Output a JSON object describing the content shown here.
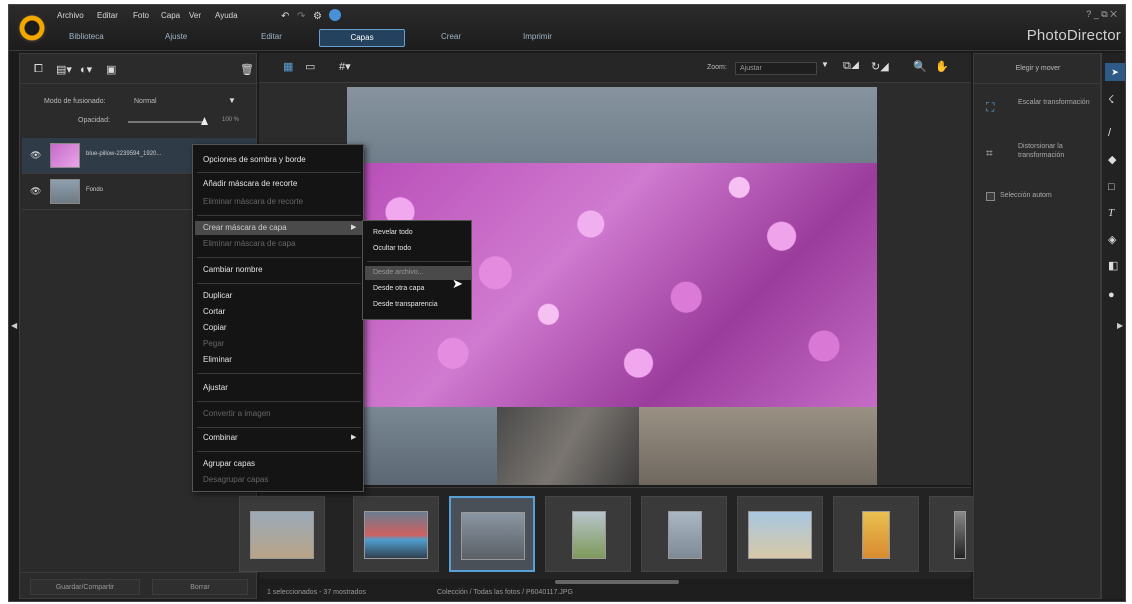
{
  "menu": [
    "Archivo",
    "Editar",
    "Foto",
    "Capa",
    "Ver",
    "Ayuda"
  ],
  "tabs": [
    "Biblioteca",
    "Ajuste",
    "Editar",
    "Capas",
    "Crear",
    "Imprimir"
  ],
  "brand": "PhotoDirector",
  "window_controls": "?  _  ⧉  ✕",
  "left_panel": {
    "blend_label": "Modo de fusionado:",
    "blend_value": "Normal",
    "opacity_label": "Opacidad:",
    "opacity_value": "100 %",
    "opacity_level": 1.0,
    "layers": [
      {
        "name": "blue-pillow-2239594_1920..."
      },
      {
        "name": "Fondo"
      }
    ],
    "save_share": "Guardar/Compartir",
    "delete": "Borrar"
  },
  "toolbar": {
    "zoom_label": "Zoom:",
    "zoom_value": "Ajustar"
  },
  "context_menu": {
    "items": [
      {
        "label": "Opciones de sombra y borde",
        "enabled": true
      },
      {
        "label": "Añadir máscara de recorte",
        "enabled": true
      },
      {
        "label": "Eliminar máscara de recorte",
        "enabled": false
      },
      {
        "label": "Crear máscara de capa",
        "enabled": true,
        "highlighted": true,
        "submenu": true
      },
      {
        "label": "Eliminar máscara de capa",
        "enabled": false
      },
      {
        "label": "Cambiar nombre",
        "enabled": true
      },
      {
        "label": "Duplicar",
        "enabled": true
      },
      {
        "label": "Cortar",
        "enabled": true
      },
      {
        "label": "Copiar",
        "enabled": true
      },
      {
        "label": "Pegar",
        "enabled": false
      },
      {
        "label": "Eliminar",
        "enabled": true
      },
      {
        "label": "Ajustar",
        "enabled": true
      },
      {
        "label": "Convertir a imagen",
        "enabled": false
      },
      {
        "label": "Combinar",
        "enabled": true,
        "submenu": true
      },
      {
        "label": "Agrupar capas",
        "enabled": true
      },
      {
        "label": "Desagrupar capas",
        "enabled": false
      }
    ],
    "submenu_items": [
      "Revelar todo",
      "Ocultar todo",
      "Desde archivo...",
      "Desde otra capa",
      "Desde transparencia"
    ]
  },
  "status": {
    "count": "1 seleccionados - 37 mostrados",
    "path": "Colección / Todas las fotos / P6040117.JPG"
  },
  "right_panel": {
    "header": "Elegir y mover",
    "scale": "Escalar transformación",
    "distort": "Distorsionar la transformación",
    "auto_select": "Selección autom"
  },
  "colors": {
    "accent": "#5aa0d8",
    "bg": "#1b1b1b",
    "panel": "#2b2b2b"
  }
}
